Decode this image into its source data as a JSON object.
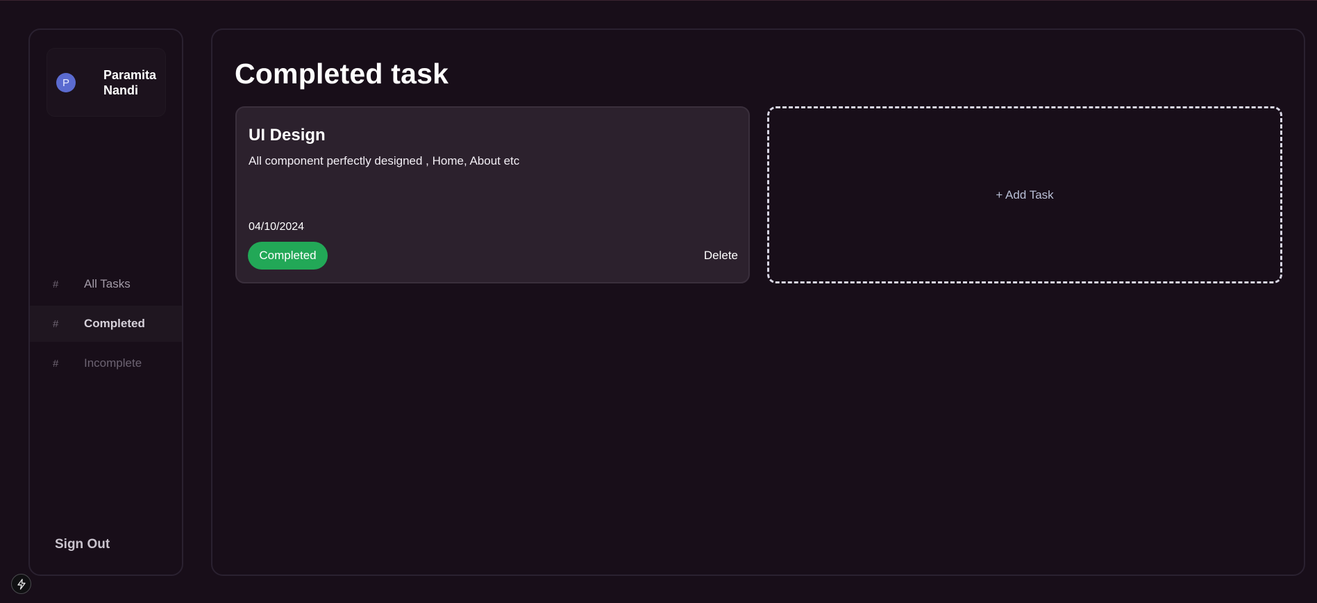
{
  "user": {
    "initial": "P",
    "name": "Paramita Nandi"
  },
  "sidebar": {
    "items": [
      {
        "icon": "#",
        "label": "All Tasks"
      },
      {
        "icon": "#",
        "label": "Completed"
      },
      {
        "icon": "#",
        "label": "Incomplete"
      }
    ],
    "active_index": 1,
    "sign_out_label": "Sign Out"
  },
  "main": {
    "title": "Completed task",
    "tasks": [
      {
        "title": "UI Design",
        "description": "All component perfectly designed , Home, About etc",
        "date": "04/10/2024",
        "status_label": "Completed",
        "delete_label": "Delete"
      }
    ],
    "add_task_label": "+ Add Task"
  },
  "colors": {
    "background": "#180e19",
    "card": "#2c212d",
    "status_green": "#22a857",
    "avatar_blue": "#5b6bd0"
  },
  "icons": {
    "bolt": "lightning-bolt-icon"
  }
}
